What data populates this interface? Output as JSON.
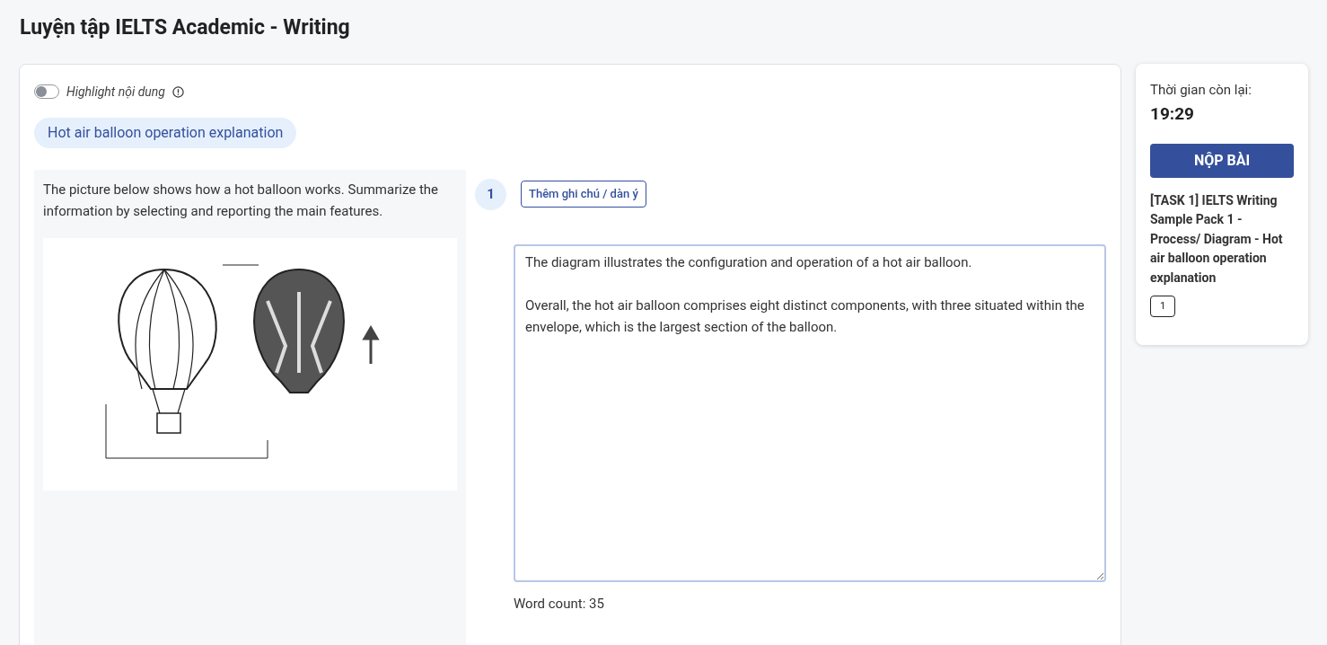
{
  "page_title": "Luyện tập IELTS Academic - Writing",
  "highlight_toggle": {
    "label": "Highlight nội dung",
    "on": false
  },
  "task_tag": "Hot air balloon operation explanation",
  "prompt": "The picture below shows how a hot balloon works. Summarize the information by selecting and reporting the main features.",
  "question": {
    "number": "1",
    "note_button": "Thêm ghi chú / dàn ý",
    "answer": "The diagram illustrates the configuration and operation of a hot air balloon.\n\nOverall, the hot air balloon comprises eight distinct components, with three situated within the envelope, which is the largest section of the balloon.",
    "word_count": "Word count: 35"
  },
  "sidebar": {
    "timer_label": "Thời gian còn lại:",
    "timer": "19:29",
    "submit": "NỘP BÀI",
    "task_title": "[TASK 1] IELTS Writing Sample Pack 1 - Process/ Diagram - Hot air balloon operation explanation",
    "question_numbers": [
      "1"
    ]
  }
}
